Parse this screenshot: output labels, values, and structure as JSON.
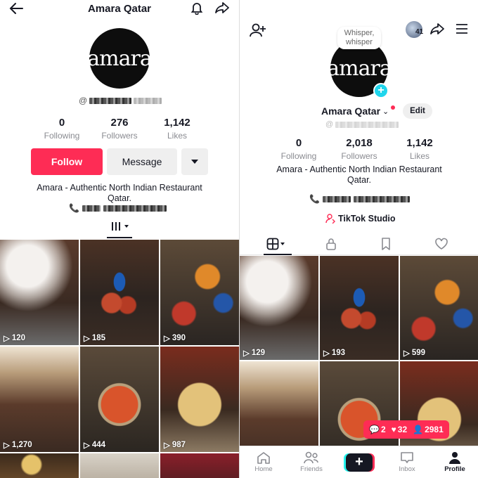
{
  "left": {
    "header": {
      "title": "Amara Qatar"
    },
    "logo_text": "amara",
    "username": "@",
    "stats": [
      {
        "value": "0",
        "label": "Following"
      },
      {
        "value": "276",
        "label": "Followers"
      },
      {
        "value": "1,142",
        "label": "Likes"
      }
    ],
    "follow_label": "Follow",
    "message_label": "Message",
    "bio_line1": "Amara - Authentic North Indian Restaurant",
    "bio_line2": "Qatar.",
    "videos": [
      {
        "views": "120"
      },
      {
        "views": "185"
      },
      {
        "views": "390"
      },
      {
        "views": "1,270"
      },
      {
        "views": "444"
      },
      {
        "views": "987"
      }
    ]
  },
  "right": {
    "avatar_count": "41",
    "bubble_text": "Whisper, whisper",
    "logo_text": "amara",
    "name": "Amara Qatar",
    "edit_label": "Edit",
    "username": "@",
    "stats": [
      {
        "value": "0",
        "label": "Following"
      },
      {
        "value": "2,018",
        "label": "Followers"
      },
      {
        "value": "1,142",
        "label": "Likes"
      }
    ],
    "bio_line1": "Amara - Authentic North Indian Restaurant",
    "bio_line2": "Qatar.",
    "studio_label": "TikTok Studio",
    "videos": [
      {
        "views": "129"
      },
      {
        "views": "193"
      },
      {
        "views": "599"
      }
    ],
    "notif": {
      "comments": "2",
      "likes": "32",
      "followers": "2981"
    },
    "nav": [
      {
        "label": "Home"
      },
      {
        "label": "Friends"
      },
      {
        "label": ""
      },
      {
        "label": "Inbox"
      },
      {
        "label": "Profile"
      }
    ]
  },
  "colors": {
    "accent": "#fe2c55",
    "text": "#161823",
    "muted": "#8a8b91",
    "studio_icon": "#fe2c55",
    "plus_badge": "#20d5ec"
  }
}
